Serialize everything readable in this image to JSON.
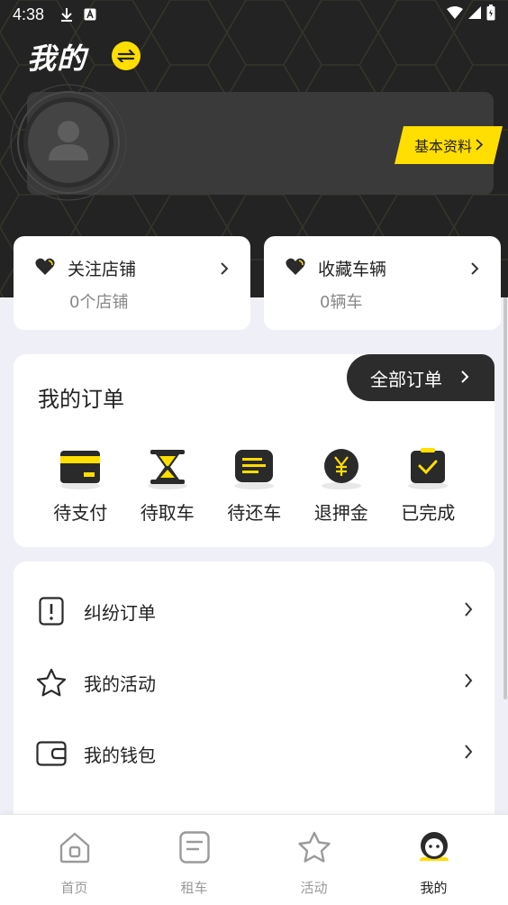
{
  "status_bar": {
    "time": "4:38"
  },
  "header": {
    "title": "我的",
    "basic_info_label": "基本资料"
  },
  "colors": {
    "accent": "#ffde00",
    "dark": "#232323",
    "bg": "#eff0f7"
  },
  "follow": [
    {
      "title": "关注店铺",
      "count_text": "0个店铺",
      "icon": "heart-icon"
    },
    {
      "title": "收藏车辆",
      "count_text": "0辆车",
      "icon": "heart-icon"
    }
  ],
  "orders": {
    "title": "我的订单",
    "all_label": "全部订单",
    "items": [
      {
        "label": "待支付",
        "icon": "card-icon"
      },
      {
        "label": "待取车",
        "icon": "hourglass-icon"
      },
      {
        "label": "待还车",
        "icon": "document-icon"
      },
      {
        "label": "退押金",
        "icon": "yen-icon"
      },
      {
        "label": "已完成",
        "icon": "check-clipboard-icon"
      }
    ]
  },
  "menu": [
    {
      "label": "纠纷订单",
      "icon": "exclamation-icon"
    },
    {
      "label": "我的活动",
      "icon": "star-icon"
    },
    {
      "label": "我的钱包",
      "icon": "wallet-icon"
    }
  ],
  "tabbar": [
    {
      "label": "首页",
      "icon": "home-icon",
      "active": false
    },
    {
      "label": "租车",
      "icon": "list-icon",
      "active": false
    },
    {
      "label": "活动",
      "icon": "star-icon",
      "active": false
    },
    {
      "label": "我的",
      "icon": "user-face-icon",
      "active": true
    }
  ]
}
